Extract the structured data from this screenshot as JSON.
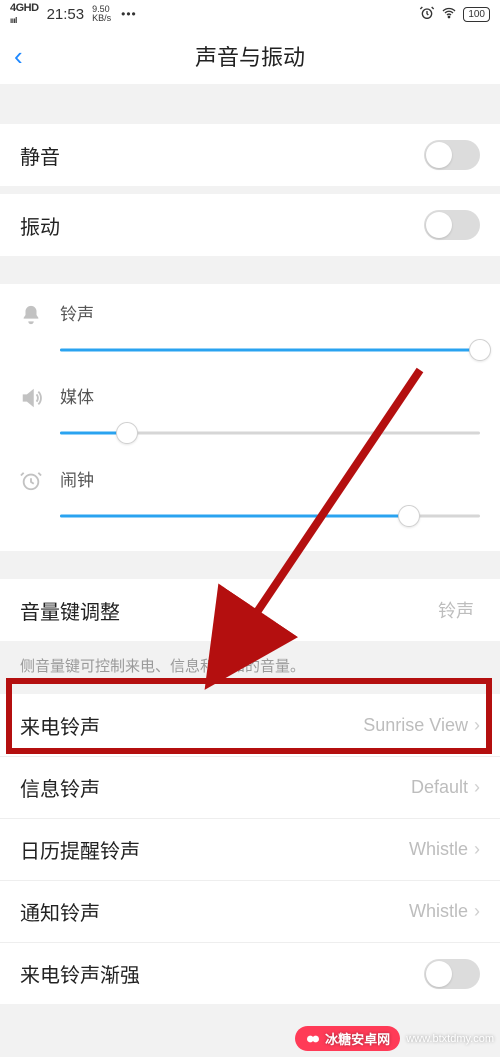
{
  "statusbar": {
    "signal_label": "4GHD",
    "time": "21:53",
    "rate_top": "9.50",
    "rate_bot": "KB/s",
    "dots": "•••",
    "alarm_icon": "⏰",
    "wifi_icon": "wifi",
    "battery": "100"
  },
  "header": {
    "back_glyph": "‹",
    "title": "声音与振动"
  },
  "toggles": {
    "mute": {
      "label": "静音",
      "on": false
    },
    "vibrate": {
      "label": "振动",
      "on": false
    }
  },
  "sliders": {
    "ring": {
      "label": "铃声",
      "value_pct": 100
    },
    "media": {
      "label": "媒体",
      "value_pct": 16
    },
    "alarm": {
      "label": "闹钟",
      "value_pct": 83
    }
  },
  "volumekey": {
    "label": "音量键调整",
    "value": "铃声",
    "desc": "侧音量键可控制来电、信息和通知的音量。"
  },
  "ringtones": {
    "incoming": {
      "label": "来电铃声",
      "value": "Sunrise View"
    },
    "message": {
      "label": "信息铃声",
      "value": "Default"
    },
    "calendar": {
      "label": "日历提醒铃声",
      "value": "Whistle"
    },
    "notify": {
      "label": "通知铃声",
      "value": "Whistle"
    },
    "ascend": {
      "label": "来电铃声渐强",
      "on": false
    }
  },
  "watermark": {
    "brand": "冰糖安卓网",
    "url": "www.btxtdmy.com"
  },
  "annotation": {
    "highlight_target": "incoming-call-ringtone",
    "arrow_color": "#b40f0f"
  }
}
